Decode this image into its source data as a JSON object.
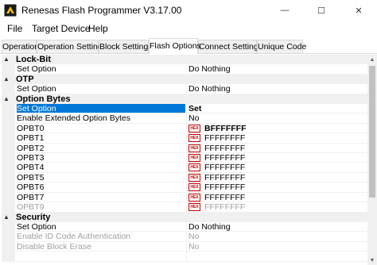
{
  "window": {
    "title": "Renesas Flash Programmer V3.17.00",
    "minimize_symbol": "—",
    "maximize_symbol": "☐",
    "close_symbol": "✕",
    "icon": "renesas-app-icon"
  },
  "menu": [
    "File",
    "Target Device",
    "Help"
  ],
  "tabs": [
    {
      "label": "Operation"
    },
    {
      "label": "Operation Settings"
    },
    {
      "label": "Block Settings"
    },
    {
      "label": "Flash Options",
      "active": true
    },
    {
      "label": "Connect Settings"
    },
    {
      "label": "Unique Code"
    }
  ],
  "grid": {
    "toggle_symbol": "▲",
    "dropdown_symbol": "⌄",
    "hex_icon_text": "HEX",
    "rows": [
      {
        "kind": "category",
        "title": "Lock-Bit"
      },
      {
        "kind": "prop",
        "name": "Set Option",
        "value": "Do Nothing"
      },
      {
        "kind": "category",
        "title": "OTP"
      },
      {
        "kind": "prop",
        "name": "Set Option",
        "value": "Do Nothing"
      },
      {
        "kind": "category",
        "title": "Option Bytes"
      },
      {
        "kind": "prop",
        "name": "Set Option",
        "value": "Set",
        "selected": true
      },
      {
        "kind": "prop",
        "name": "Enable Extended Option Bytes",
        "value": "No"
      },
      {
        "kind": "hex",
        "name": "OPBT0",
        "value": "BFFFFFFF",
        "bold": true
      },
      {
        "kind": "hex",
        "name": "OPBT1",
        "value": "FFFFFFFF"
      },
      {
        "kind": "hex",
        "name": "OPBT2",
        "value": "FFFFFFFF"
      },
      {
        "kind": "hex",
        "name": "OPBT3",
        "value": "FFFFFFFF"
      },
      {
        "kind": "hex",
        "name": "OPBT4",
        "value": "FFFFFFFF"
      },
      {
        "kind": "hex",
        "name": "OPBT5",
        "value": "FFFFFFFF"
      },
      {
        "kind": "hex",
        "name": "OPBT6",
        "value": "FFFFFFFF"
      },
      {
        "kind": "hex",
        "name": "OPBT7",
        "value": "FFFFFFFF"
      },
      {
        "kind": "hex",
        "name": "OPBT9",
        "value": "FFFFFFFF",
        "disabled": true
      },
      {
        "kind": "category",
        "title": "Security"
      },
      {
        "kind": "prop",
        "name": "Set Option",
        "value": "Do Nothing"
      },
      {
        "kind": "prop",
        "name": "Enable ID Code Authentication",
        "value": "No",
        "disabled": true
      },
      {
        "kind": "prop",
        "name": "Disable Block Erase",
        "value": "No",
        "disabled": true
      },
      {
        "kind": "prop",
        "name": "",
        "value": ""
      }
    ]
  },
  "scrollbar": {
    "up_symbol": "▲",
    "down_symbol": "▼"
  },
  "colors": {
    "selection": "#0078d7",
    "hex_icon": "#c00000",
    "gutter": "#f0f0f0"
  }
}
